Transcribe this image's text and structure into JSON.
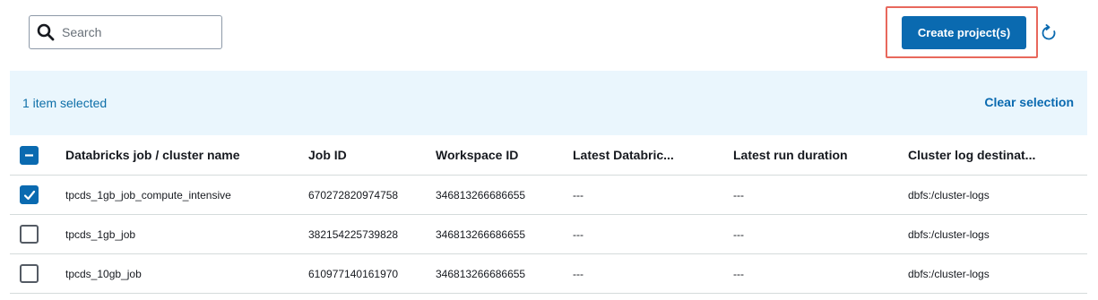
{
  "search": {
    "placeholder": "Search",
    "value": "",
    "icon": "search-icon"
  },
  "toolbar": {
    "create_label": "Create project(s)",
    "refresh_icon": "refresh-icon",
    "accent": "#0a6ab0",
    "highlight": "#e8685c"
  },
  "selection": {
    "count_text": "1 item selected",
    "clear_label": "Clear selection",
    "background": "#eaf6fd"
  },
  "table": {
    "columns": [
      "Databricks job / cluster name",
      "Job ID",
      "Workspace ID",
      "Latest Databric...",
      "Latest run duration",
      "Cluster log destinat..."
    ],
    "header_checkbox_state": "indeterminate",
    "rows": [
      {
        "selected": true,
        "name": "tpcds_1gb_job_compute_intensive",
        "job_id": "670272820974758",
        "workspace_id": "346813266686655",
        "latest": "---",
        "duration": "---",
        "log_dest": "dbfs:/cluster-logs"
      },
      {
        "selected": false,
        "name": "tpcds_1gb_job",
        "job_id": "382154225739828",
        "workspace_id": "346813266686655",
        "latest": "---",
        "duration": "---",
        "log_dest": "dbfs:/cluster-logs"
      },
      {
        "selected": false,
        "name": "tpcds_10gb_job",
        "job_id": "610977140161970",
        "workspace_id": "346813266686655",
        "latest": "---",
        "duration": "---",
        "log_dest": "dbfs:/cluster-logs"
      }
    ]
  }
}
